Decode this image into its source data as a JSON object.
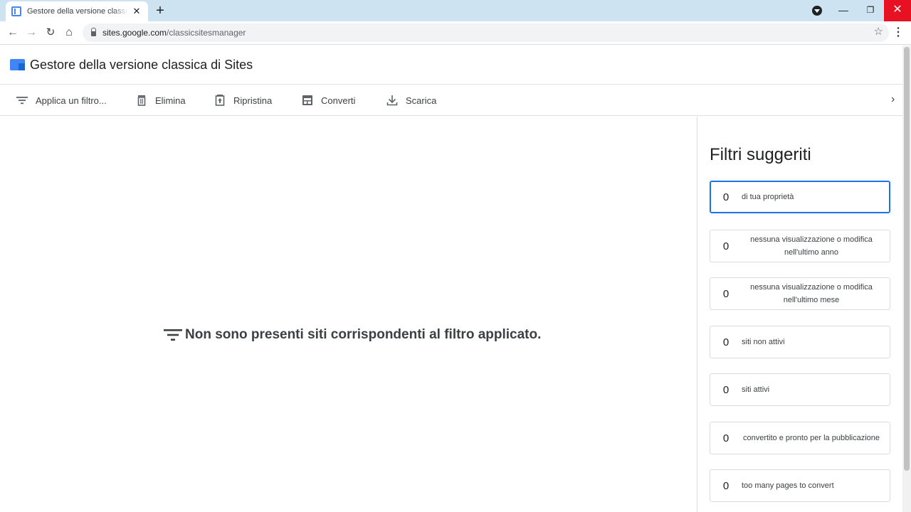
{
  "browser": {
    "tab_title": "Gestore della versione classica di Sites",
    "url_host": "sites.google.com",
    "url_path": "/classicsitesmanager"
  },
  "app": {
    "title": "Gestore della versione classica di Sites"
  },
  "actions": {
    "filter": "Applica un filtro...",
    "delete": "Elimina",
    "restore": "Ripristina",
    "convert": "Converti",
    "download": "Scarica"
  },
  "main": {
    "empty_message": "Non sono presenti siti corrispondenti al filtro applicato."
  },
  "side": {
    "title": "Filtri suggeriti",
    "filters": [
      {
        "count": "0",
        "label": "di tua proprietà"
      },
      {
        "count": "0",
        "label": "nessuna visualizzazione o modifica nell'ultimo anno"
      },
      {
        "count": "0",
        "label": "nessuna visualizzazione o modifica nell'ultimo mese"
      },
      {
        "count": "0",
        "label": "siti non attivi"
      },
      {
        "count": "0",
        "label": "siti attivi"
      },
      {
        "count": "0",
        "label": "convertito e pronto per la pubblicazione"
      },
      {
        "count": "0",
        "label": "too many pages to convert"
      }
    ]
  },
  "colors": {
    "accent": "#1a73e8",
    "close_button": "#e81123",
    "tabstrip": "#cde3f1"
  }
}
